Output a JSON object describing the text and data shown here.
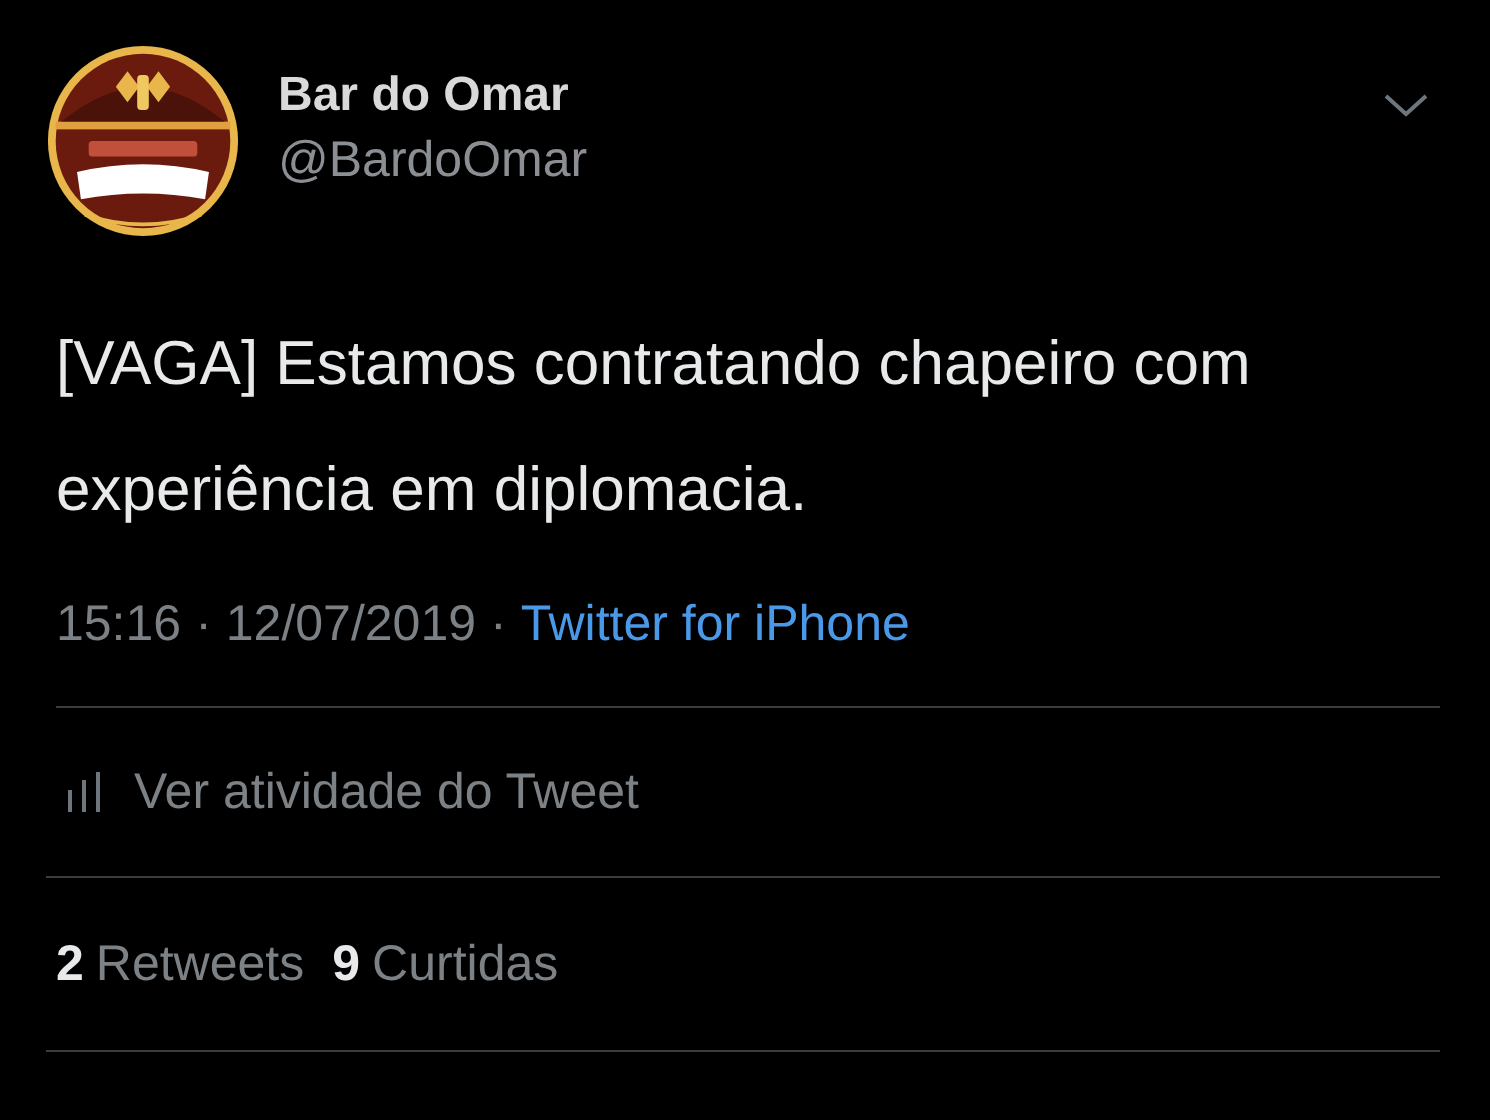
{
  "author": {
    "name": "Bar do Omar",
    "handle": "@BardoOmar"
  },
  "tweet": {
    "text": "[VAGA] Estamos contratando chapeiro com experiência em diplomacia."
  },
  "meta": {
    "time": "15:16",
    "separator_1": "·",
    "date": "12/07/2019",
    "separator_2": "·",
    "source": "Twitter for iPhone"
  },
  "activity": {
    "label": "Ver atividade do Tweet"
  },
  "stats": [
    {
      "count": "2",
      "label": "Retweets"
    },
    {
      "count": "9",
      "label": "Curtidas"
    }
  ]
}
